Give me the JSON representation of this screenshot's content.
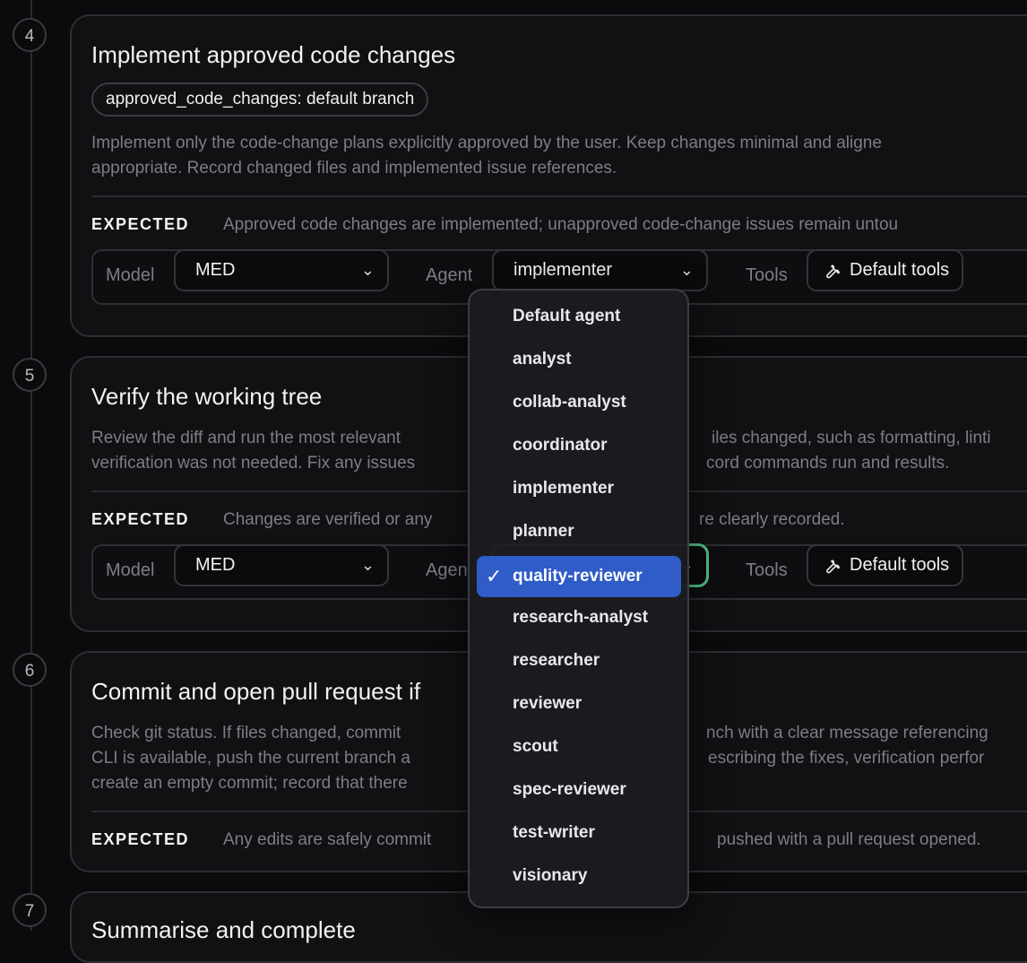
{
  "steps": [
    {
      "number": "4",
      "title": "Implement approved code changes",
      "pill": "approved_code_changes: default branch",
      "description": [
        "Implement only the code-change plans explicitly approved by the user. Keep changes minimal and aligne",
        "appropriate. Record changed files and implemented issue references."
      ],
      "expected_label": "EXPECTED",
      "expected": "Approved code changes are implemented; unapproved code-change issues remain untou",
      "model_label": "Model",
      "model": "MED",
      "agent_label": "Agent",
      "agent": "implementer",
      "tools_label": "Tools",
      "tools": "Default tools"
    },
    {
      "number": "5",
      "title": "Verify the working tree",
      "description": [
        "Review the diff and run the most relevant",
        "iles changed, such as formatting, linti",
        "verification was not needed. Fix any issues",
        "cord commands run and results."
      ],
      "expected_label": "EXPECTED",
      "expected": "Changes are verified or any",
      "expected_tail": "re clearly recorded.",
      "model_label": "Model",
      "model": "MED",
      "agent_label": "Agen",
      "tools_label": "Tools",
      "tools": "Default tools"
    },
    {
      "number": "6",
      "title": "Commit and open pull request if",
      "description": [
        "Check git status. If files changed, commit",
        "nch with a clear message referencing",
        "CLI is available, push the current branch a",
        "escribing the fixes, verification perfor",
        "create an empty commit; record that there"
      ],
      "expected_label": "EXPECTED",
      "expected": "Any edits are safely commit",
      "expected_tail": "pushed with a pull request opened."
    },
    {
      "number": "7",
      "title": "Summarise and complete"
    }
  ],
  "agent_dropdown": {
    "selected": "quality-reviewer",
    "options": [
      "Default agent",
      "analyst",
      "collab-analyst",
      "coordinator",
      "implementer",
      "planner",
      "quality-reviewer",
      "research-analyst",
      "researcher",
      "reviewer",
      "scout",
      "spec-reviewer",
      "test-writer",
      "visionary"
    ]
  },
  "colors": {
    "accent_selected": "#2f5cc7",
    "focus_ring": "#4fc38a"
  },
  "icons": {
    "chevron": "chevron-down-icon",
    "tools": "wrench-icon",
    "check": "checkmark-icon"
  }
}
